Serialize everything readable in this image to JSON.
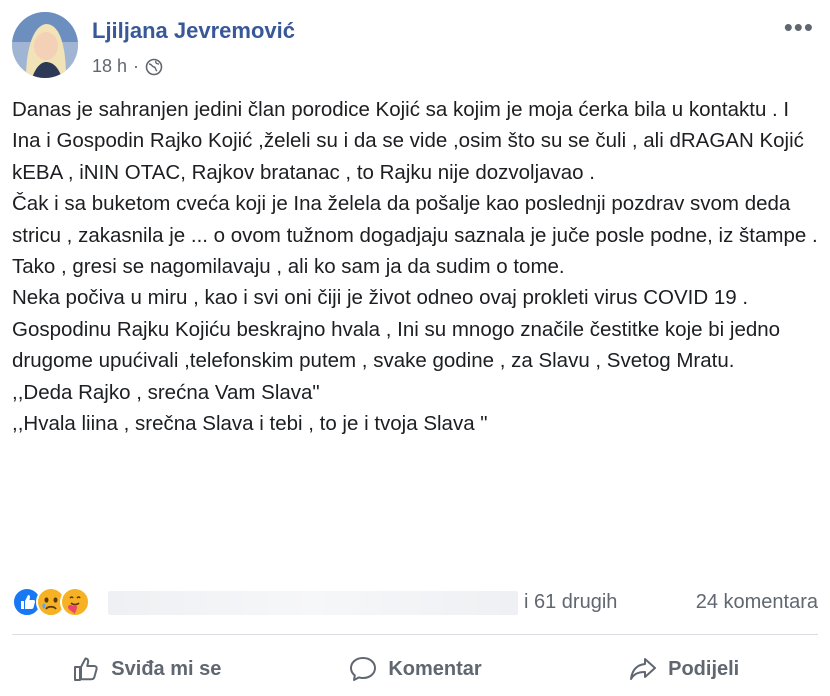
{
  "post": {
    "author": "Ljiljana Jevremović",
    "time": "18 h",
    "dot": "·",
    "paragraphs": [
      "Danas je sahranjen jedini član porodice Kojić sa kojim je moja ćerka bila u kontaktu . I Ina i Gospodin Rajko Kojić ,želeli su i da se vide ,osim što su se čuli , ali dRAGAN Kojić kEBA , iNIN OTAC, Rajkov bratanac , to Rajku nije dozvoljavao .",
      "Čak i sa buketom cveća koji je Ina želela da pošalje kao poslednji pozdrav svom deda stricu , zakasnila je ... o ovom tužnom dogadjaju saznala je juče posle podne, iz štampe .",
      "Tako , gresi se nagomilavaju , ali ko sam ja da sudim o tome.",
      "Neka počiva u miru , kao i svi oni čiji je život odneo ovaj prokleti virus COVID 19 .",
      "Gospodinu Rajku Kojiću beskrajno hvala , Ini su mnogo značile čestitke koje bi jedno drugome upućivali ,telefonskim putem , svake godine , za Slavu , Svetog Mratu.",
      ",,Deda Rajko , srećna Vam Slava\"",
      ",,Hvala liina , srečna Slava i tebi , to je i tvoja Slava \""
    ]
  },
  "reactions": {
    "icons": [
      "like-icon",
      "sad-icon",
      "care-icon"
    ],
    "others": "i 61 drugih",
    "comments": "24 komentara"
  },
  "actions": {
    "like": "Sviđa mi se",
    "comment": "Komentar",
    "share": "Podijeli"
  },
  "colors": {
    "author": "#385898",
    "meta": "#606770",
    "like_blue": "#1877f2",
    "sad_yellow": "#f7b125"
  }
}
